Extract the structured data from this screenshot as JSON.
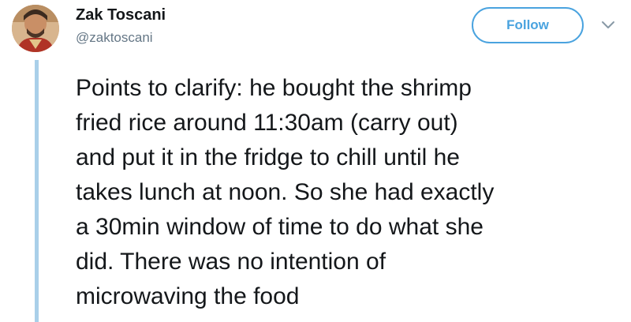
{
  "user": {
    "display_name": "Zak Toscani",
    "handle": "@zaktoscani"
  },
  "actions": {
    "follow_label": "Follow",
    "follow_color": "#4aa3df"
  },
  "icons": {
    "menu": "chevron-down-icon"
  },
  "thread_line_color": "#a9cfe9",
  "tweet": {
    "lines": [
      "Points to clarify: he bought the shrimp",
      "fried rice around 11:30am (carry out)",
      "and put it in the fridge to chill until he",
      "takes lunch at noon. So she had exactly",
      "a 30min window of time to do what she",
      "did. There was no intention of",
      "microwaving the food"
    ]
  }
}
